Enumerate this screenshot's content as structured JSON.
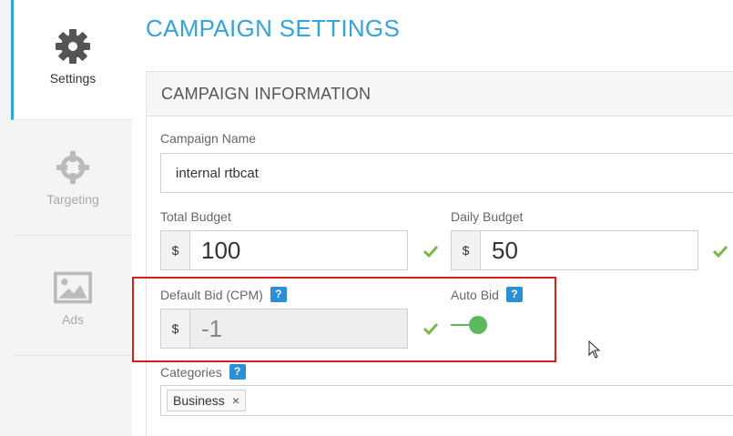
{
  "sidebar": {
    "items": [
      {
        "label": "Settings",
        "icon": "gear-icon",
        "active": true
      },
      {
        "label": "Targeting",
        "icon": "crosshair-icon",
        "active": false
      },
      {
        "label": "Ads",
        "icon": "image-icon",
        "active": false
      }
    ]
  },
  "page": {
    "title": "CAMPAIGN SETTINGS"
  },
  "panel": {
    "title": "CAMPAIGN INFORMATION"
  },
  "form": {
    "campaign_name": {
      "label": "Campaign Name",
      "value": "internal rtbcat"
    },
    "total_budget": {
      "label": "Total Budget",
      "currency": "$",
      "value": "100"
    },
    "daily_budget": {
      "label": "Daily Budget",
      "currency": "$",
      "value": "50"
    },
    "default_bid": {
      "label": "Default Bid (CPM)",
      "currency": "$",
      "value": "-1",
      "help": "?"
    },
    "auto_bid": {
      "label": "Auto Bid",
      "help": "?",
      "enabled": true
    },
    "categories": {
      "label": "Categories",
      "help": "?",
      "tags": [
        {
          "label": "Business",
          "remove": "×"
        }
      ]
    }
  },
  "colors": {
    "accent": "#35a3de",
    "check": "#7ab648",
    "toggle": "#5cb85c",
    "highlight": "#e01b1b",
    "help": "#2a8fd6"
  }
}
